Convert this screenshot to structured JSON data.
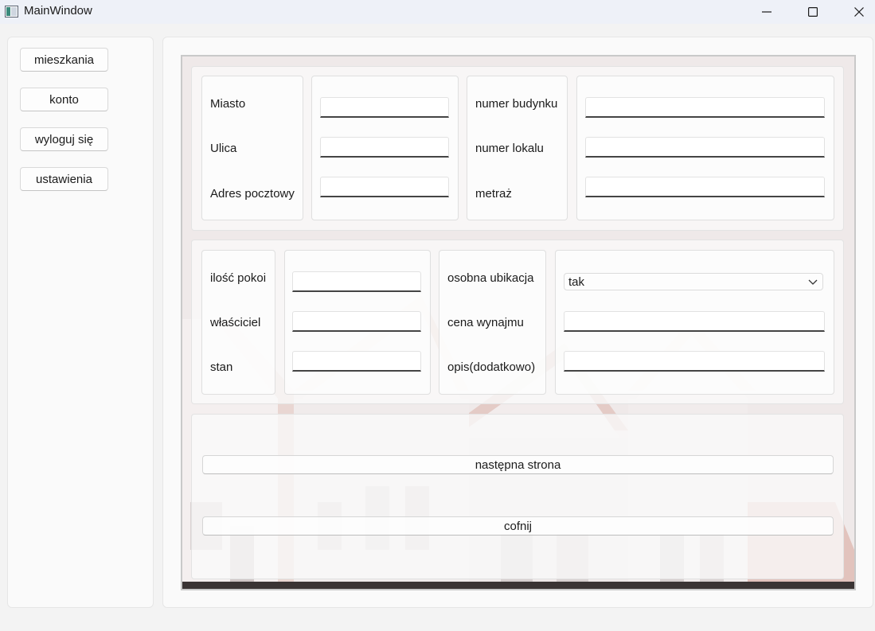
{
  "window": {
    "title": "MainWindow"
  },
  "nav": {
    "items": [
      {
        "label": "mieszkania"
      },
      {
        "label": "konto"
      },
      {
        "label": "wyloguj się"
      },
      {
        "label": "ustawienia"
      }
    ]
  },
  "address": {
    "city_label": "Miasto",
    "street_label": "Ulica",
    "postal_label": "Adres pocztowy",
    "building_label": "numer budynku",
    "unit_label": "numer lokalu",
    "area_label": "metraż"
  },
  "details": {
    "rooms_label": "ilość pokoi",
    "owner_label": "właściciel",
    "state_label": "stan",
    "toilet_label": "osobna ubikacja",
    "toilet_value": "tak",
    "rent_label": "cena wynajmu",
    "description_label": "opis(dodatkowo)"
  },
  "actions": {
    "next_label": "następna strona",
    "back_label": "cofnij"
  }
}
